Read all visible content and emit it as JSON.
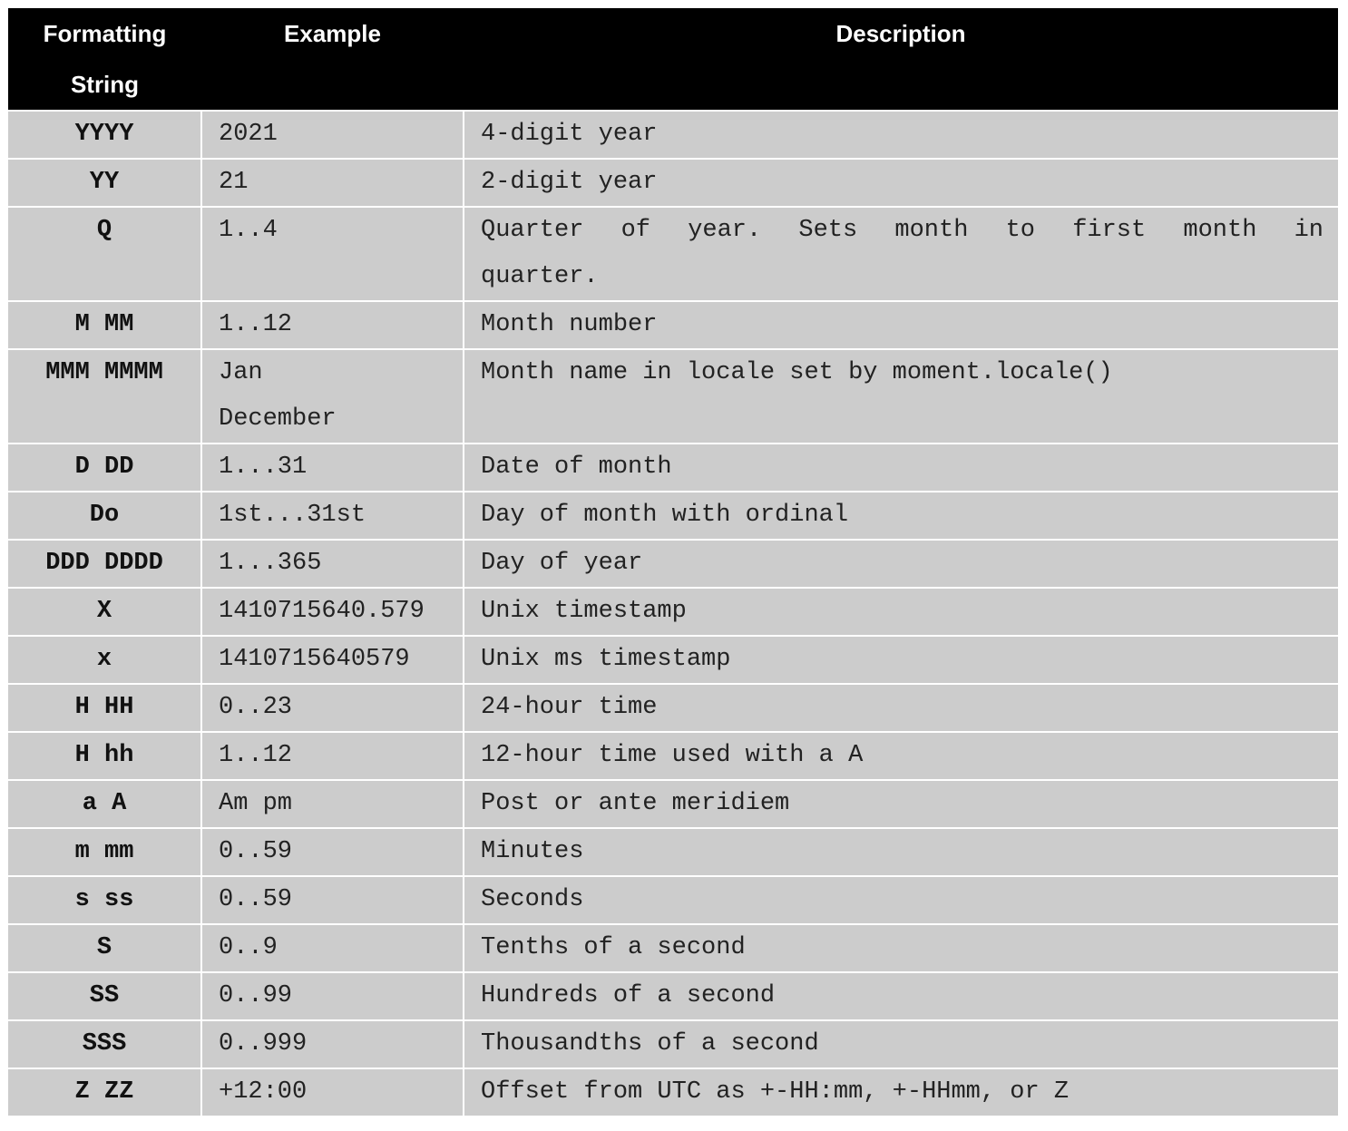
{
  "table": {
    "headers": {
      "format_line1": "Formatting",
      "format_line2": "String",
      "example": "Example",
      "description": "Description"
    },
    "rows": [
      {
        "format": "YYYY",
        "example": "2021",
        "description": "4-digit year"
      },
      {
        "format": "YY",
        "example": "21",
        "description": "2-digit year"
      },
      {
        "format": "Q",
        "example": "1..4",
        "description": "Quarter of year. Sets month to first month in quarter."
      },
      {
        "format": "M MM",
        "example": "1..12",
        "description": "Month number"
      },
      {
        "format": "MMM MMMM",
        "example_line1": "Jan",
        "example_line2": "December",
        "description": "Month name in locale set by moment.locale()"
      },
      {
        "format": "D DD",
        "example": "1...31",
        "description": "Date of month"
      },
      {
        "format": "Do",
        "example": "1st...31st",
        "description": "Day of month with ordinal"
      },
      {
        "format": "DDD DDDD",
        "example": "1...365",
        "description": "Day of year"
      },
      {
        "format": "X",
        "example": "1410715640.579",
        "description": "Unix timestamp"
      },
      {
        "format": "x",
        "example": "1410715640579",
        "description": "Unix ms timestamp"
      },
      {
        "format": "H HH",
        "example": "0..23",
        "description": "24-hour time"
      },
      {
        "format": "H hh",
        "example": "1..12",
        "description": "12-hour time used with a A"
      },
      {
        "format": "a A",
        "example": "Am pm",
        "description": "Post or ante meridiem"
      },
      {
        "format": "m mm",
        "example": "0..59",
        "description": "Minutes"
      },
      {
        "format": "s ss",
        "example": "0..59",
        "description": "Seconds"
      },
      {
        "format": "S",
        "example": "0..9",
        "description": "Tenths of a second"
      },
      {
        "format": "SS",
        "example": "0..99",
        "description": "Hundreds of a second"
      },
      {
        "format": "SSS",
        "example": "0..999",
        "description": "Thousandths of a second"
      },
      {
        "format": "Z ZZ",
        "example": "+12:00",
        "description": "Offset from UTC as +-HH:mm, +-HHmm, or Z"
      }
    ]
  }
}
